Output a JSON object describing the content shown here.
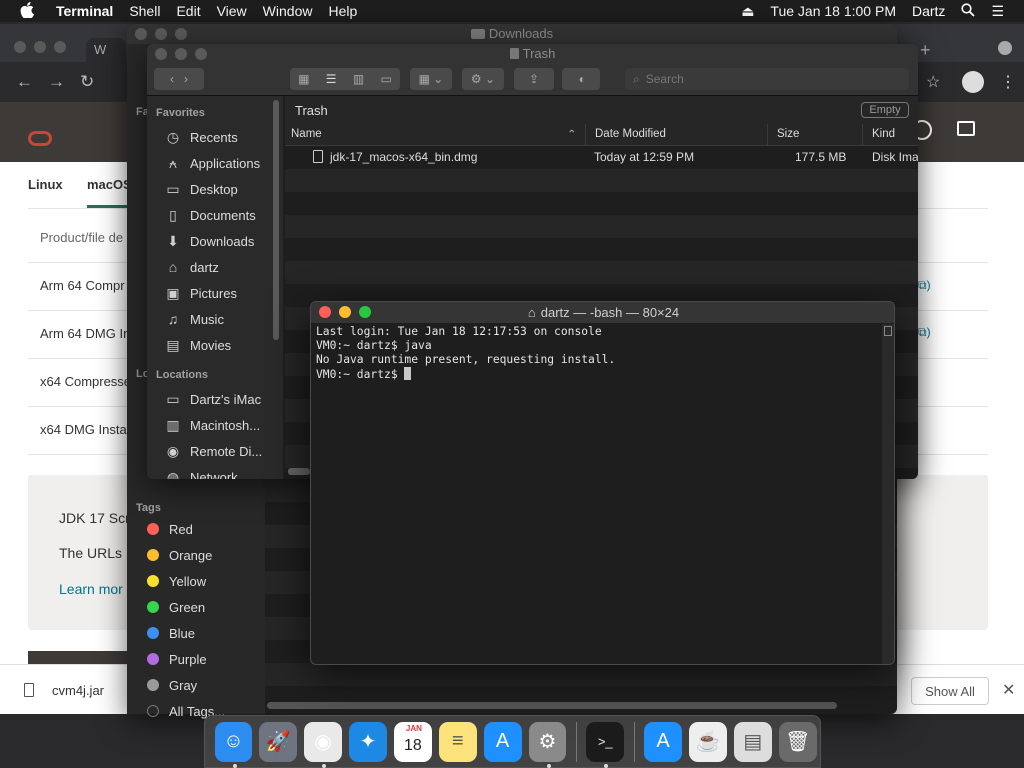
{
  "menubar": {
    "apple": "",
    "app_name": "Terminal",
    "items": [
      "Shell",
      "Edit",
      "View",
      "Window",
      "Help"
    ],
    "datetime": "Tue Jan 18  1:00 PM",
    "user": "Dartz"
  },
  "browser": {
    "tab_prefix": "W",
    "os_tabs": [
      "Linux",
      "macOS"
    ],
    "table_header": "Product/file de",
    "rows": [
      "Arm 64 Compr",
      "Arm 64 DMG In",
      "x64 Compresse",
      "x64 DMG Insta"
    ],
    "notice_lines": [
      "JDK 17 Scr",
      "The URLs"
    ],
    "notice_link": "Learn mor",
    "download_file": "cvm4j.jar",
    "show_all": "Show All"
  },
  "downloads_window": {
    "title": "Downloads",
    "sidebar_partial": [
      "Fa",
      "Lo"
    ],
    "tags_header": "Tags",
    "tags": [
      {
        "label": "Red",
        "color": "#fe5f57"
      },
      {
        "label": "Orange",
        "color": "#febc2e"
      },
      {
        "label": "Yellow",
        "color": "#f5e02a"
      },
      {
        "label": "Green",
        "color": "#32d74b"
      },
      {
        "label": "Blue",
        "color": "#3d8ff0"
      },
      {
        "label": "Purple",
        "color": "#b36ae2"
      },
      {
        "label": "Gray",
        "color": "#9a9a9a"
      }
    ],
    "all_tags": "All Tags..."
  },
  "trash_window": {
    "title": "Trash",
    "search_placeholder": "Search",
    "location_label": "Trash",
    "empty_button": "Empty",
    "columns": {
      "name": "Name",
      "date": "Date Modified",
      "size": "Size",
      "kind": "Kind"
    },
    "files": [
      {
        "name": "jdk-17_macos-x64_bin.dmg",
        "date": "Today at 12:59 PM",
        "size": "177.5 MB",
        "kind": "Disk Ima"
      }
    ],
    "sidebar": {
      "favorites_header": "Favorites",
      "favorites": [
        {
          "label": "Recents",
          "icon": "clock-icon"
        },
        {
          "label": "Applications",
          "icon": "applications-icon"
        },
        {
          "label": "Desktop",
          "icon": "desktop-icon"
        },
        {
          "label": "Documents",
          "icon": "documents-icon"
        },
        {
          "label": "Downloads",
          "icon": "downloads-icon"
        },
        {
          "label": "dartz",
          "icon": "home-icon"
        },
        {
          "label": "Pictures",
          "icon": "pictures-icon"
        },
        {
          "label": "Music",
          "icon": "music-icon"
        },
        {
          "label": "Movies",
          "icon": "movies-icon"
        }
      ],
      "locations_header": "Locations",
      "locations": [
        {
          "label": "Dartz's iMac",
          "icon": "imac-icon"
        },
        {
          "label": "Macintosh...",
          "icon": "disk-icon"
        },
        {
          "label": "Remote Di...",
          "icon": "remote-disc-icon"
        },
        {
          "label": "Network",
          "icon": "network-icon"
        }
      ]
    }
  },
  "terminal": {
    "title": "dartz — -bash — 80×24",
    "lines": [
      "Last login: Tue Jan 18 12:17:53 on console",
      "VM0:~ dartz$ java",
      "No Java runtime present, requesting install.",
      "VM0:~ dartz$ "
    ]
  },
  "dock": {
    "items": [
      {
        "name": "finder-icon",
        "glyph": "☺",
        "color": "#2d8cf0",
        "running": true
      },
      {
        "name": "launchpad-icon",
        "glyph": "🚀",
        "color": "#6f7580",
        "running": false
      },
      {
        "name": "chrome-icon",
        "glyph": "◉",
        "color": "#e9e9e9",
        "running": true
      },
      {
        "name": "safari-icon",
        "glyph": "✦",
        "color": "#1e88e5",
        "running": false
      },
      {
        "name": "calendar-icon",
        "glyph": "18",
        "color": "#ffffff",
        "running": false
      },
      {
        "name": "notes-icon",
        "glyph": "≡",
        "color": "#fbe27a",
        "running": false
      },
      {
        "name": "app-store-icon",
        "glyph": "A",
        "color": "#1e90ff",
        "running": false
      },
      {
        "name": "system-preferences-icon",
        "glyph": "⚙",
        "color": "#8a8a8a",
        "running": true
      },
      {
        "name": "terminal-icon",
        "glyph": ">_",
        "color": "#1b1b1b",
        "running": true
      },
      {
        "name": "app-store-downloads-icon",
        "glyph": "A",
        "color": "#1e90ff",
        "running": false
      },
      {
        "name": "java-jar-icon",
        "glyph": "☕",
        "color": "#eeeeee",
        "running": false
      },
      {
        "name": "jar-launcher-icon",
        "glyph": "▤",
        "color": "#dddddd",
        "running": false
      },
      {
        "name": "trash-icon",
        "glyph": "🗑",
        "color": "#6a6a6a",
        "running": false
      }
    ],
    "calendar_month": "JAN"
  }
}
